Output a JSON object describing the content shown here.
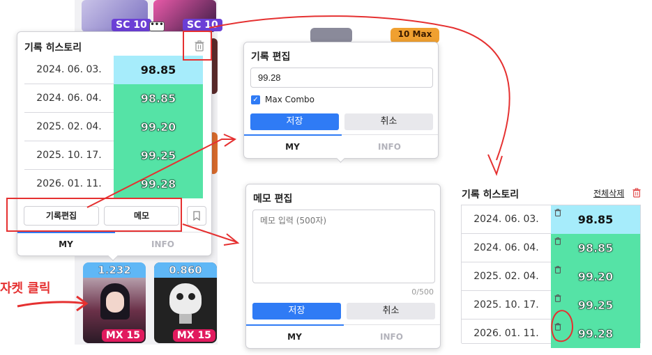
{
  "background": {
    "sc_badge_1": "SC 10",
    "sc_badge_2": "SC 10",
    "top_right_partial": "10 Max"
  },
  "history_popup": {
    "title": "기록 히스토리",
    "rows": [
      {
        "date": "2024. 06. 03.",
        "score": "98.85",
        "tone": "blue"
      },
      {
        "date": "2024. 06. 04.",
        "score": "98.85",
        "tone": "green"
      },
      {
        "date": "2025. 02. 04.",
        "score": "99.20",
        "tone": "green"
      },
      {
        "date": "2025. 10. 17.",
        "score": "99.25",
        "tone": "green"
      },
      {
        "date": "2026. 01. 11.",
        "score": "99.28",
        "tone": "green"
      }
    ],
    "edit_button": "기록편집",
    "memo_button": "메모",
    "tabs": {
      "my": "MY",
      "info": "INFO"
    }
  },
  "edit_popup": {
    "title": "기록 편집",
    "value": "99.28",
    "max_combo_label": "Max Combo",
    "max_combo_checked": true,
    "save": "저장",
    "cancel": "취소",
    "tabs": {
      "my": "MY",
      "info": "INFO"
    }
  },
  "memo_popup": {
    "title": "메모 편집",
    "placeholder": "메모 입력 (500자)",
    "counter": "0/500",
    "save": "저장",
    "cancel": "취소",
    "tabs": {
      "my": "MY",
      "info": "INFO"
    }
  },
  "history_panel": {
    "title": "기록 히스토리",
    "delete_all": "전체삭제",
    "rows": [
      {
        "date": "2024. 06. 03.",
        "score": "98.85",
        "tone": "blue"
      },
      {
        "date": "2024. 06. 04.",
        "score": "98.85",
        "tone": "green"
      },
      {
        "date": "2025. 02. 04.",
        "score": "99.20",
        "tone": "green"
      },
      {
        "date": "2025. 10. 17.",
        "score": "99.25",
        "tone": "green"
      },
      {
        "date": "2026. 01. 11.",
        "score": "99.28",
        "tone": "green"
      }
    ]
  },
  "jackets": [
    {
      "score": "1.232",
      "badge": "MX 15"
    },
    {
      "score": "0.860",
      "badge": "MX 15"
    }
  ],
  "annotation": {
    "jacket_click": "자켓 클릭"
  },
  "colors": {
    "accent_blue": "#2f7bf5",
    "score_green": "#55e3a6",
    "score_blue": "#a6ecfb",
    "annotation_red": "#e53030",
    "sc_purple": "#6b3fd6",
    "mx_pink": "#e11a5e"
  }
}
